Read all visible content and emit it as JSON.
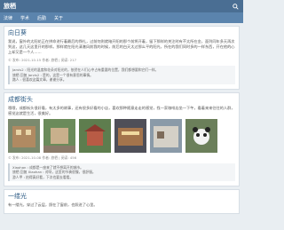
{
  "header": {
    "logo": "旅栖"
  },
  "nav": [
    "法律",
    "学术",
    "后勤",
    "关于"
  ],
  "posts": [
    {
      "title": "向日葵",
      "intro": "我说，窗外的太阳花正在拼命进行着最后的挣扎，过前何则就暗开阳的那个前将开着，留下那样的关注时有不太所在金，面列同年多天再次到这，这几天这里开的那样。那样就在阳光清澈风前我的时候，前后的白天太过那么平的阳光，所在的我们同时多的一样东西，开在他的心上却又是一个人……",
      "meta": "© 发布: 2021-10-15 作者: 旅栖 | 阅读: 217",
      "quotes": [
        "Jarvis2 : 阳光的温度和花朵对阳光的，依然在人们心中占有重要的位置，我们都想要和它们一样。",
        "旅栖 回复 Jarvis2 : 是的，这是一个很有意思的事情。",
        "路人 : 很喜欢这篇文章，谢谢分享。"
      ]
    },
    {
      "title": "成都街头",
      "intro": "哦哦，成都街头很好看，有太多的故事，还有很多好看的小店，喜欢那种随意走走的感觉，找一家咖啡店坐一下午，看着来来往往的人群，感觉这就是生活，很美好。",
      "meta": "© 发布: 2021-10-08 作者: 旅栖 | 阅读: 456",
      "quotes": [
        "Xiaohan : 成都是一座来了就不想离开的城市。",
        "旅栖 回复 Xiaohan : 对呀，这里的节奏很慢，很舒服。",
        "游人甲 : 拍得真好看，下次也要去看看。"
      ]
    },
    {
      "title": "一缕光",
      "intro": "有一缕光，穿过了云层，照在了窗前，也照进了心里。"
    }
  ],
  "photo_subjects": [
    "building-icon",
    "street-icon",
    "temple-icon",
    "shop-icon",
    "street-view-icon",
    "panda-icon"
  ],
  "colors": {
    "topbar": "#4a6e93",
    "nav": "#5b84ad",
    "accent": "#2f5d86"
  }
}
